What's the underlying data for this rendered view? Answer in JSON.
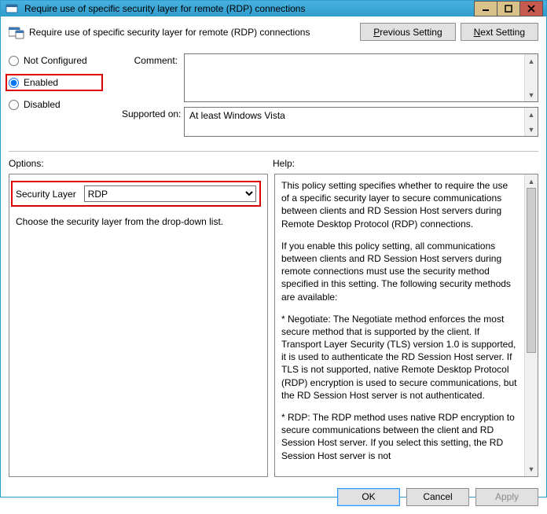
{
  "window": {
    "title": "Require use of specific security layer for remote (RDP) connections"
  },
  "header": {
    "title": "Require use of specific security layer for remote (RDP) connections",
    "prev_prefix": "P",
    "prev_rest": "revious Setting",
    "next_prefix": "N",
    "next_rest": "ext Setting"
  },
  "state": {
    "not_configured": "Not Configured",
    "enabled": "Enabled",
    "disabled": "Disabled",
    "selected": "enabled",
    "comment_label": "Comment:",
    "comment_value": "",
    "supported_label": "Supported on:",
    "supported_value": "At least Windows Vista"
  },
  "panels": {
    "options_label": "Options:",
    "help_label": "Help:"
  },
  "options": {
    "security_layer_label": "Security Layer",
    "security_layer_value": "RDP",
    "choose_hint": "Choose the security layer from the drop-down list."
  },
  "help": {
    "p1": "This policy setting specifies whether to require the use of a specific security layer to secure communications between clients and RD Session Host servers during Remote Desktop Protocol (RDP) connections.",
    "p2": "If you enable this policy setting, all communications between clients and RD Session Host servers during remote connections must use the security method specified in this setting. The following security methods are available:",
    "p3": "* Negotiate: The Negotiate method enforces the most secure method that is supported by the client. If Transport Layer Security (TLS) version 1.0 is supported, it is used to authenticate the RD Session Host server. If TLS is not supported, native Remote Desktop Protocol (RDP) encryption is used to secure communications, but the RD Session Host server is not authenticated.",
    "p4": "* RDP: The RDP method uses native RDP encryption to secure communications between the client and RD Session Host server. If you select this setting, the RD Session Host server is not"
  },
  "buttons": {
    "ok": "OK",
    "cancel": "Cancel",
    "apply": "Apply"
  }
}
